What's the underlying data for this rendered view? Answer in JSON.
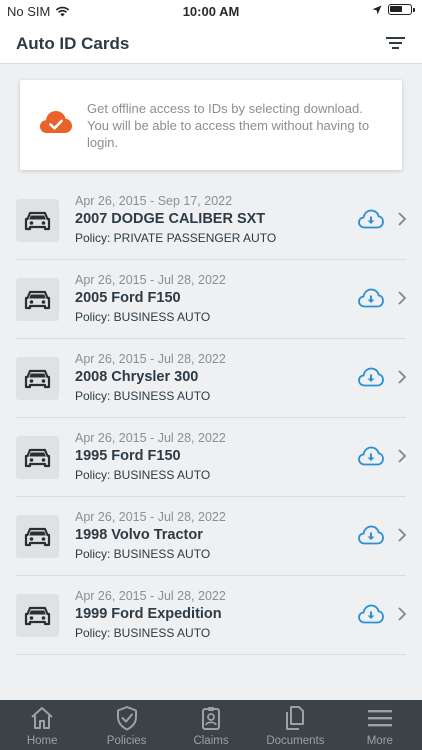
{
  "status": {
    "carrier": "No SIM",
    "time": "10:00 AM"
  },
  "header": {
    "title": "Auto ID Cards"
  },
  "notice": {
    "text": "Get offline access to IDs by selecting download. You will be able to access them without having to login."
  },
  "colors": {
    "accent_orange": "#e8632a",
    "download_blue": "#2b8fd6",
    "tabbar_bg": "#3b4248"
  },
  "cards": [
    {
      "dates": "Apr 26, 2015 - Sep 17, 2022",
      "vehicle": "2007 DODGE CALIBER SXT",
      "policy": "Policy: PRIVATE PASSENGER AUTO"
    },
    {
      "dates": "Apr 26, 2015 - Jul 28, 2022",
      "vehicle": "2005 Ford F150",
      "policy": "Policy: BUSINESS AUTO"
    },
    {
      "dates": "Apr 26, 2015 - Jul 28, 2022",
      "vehicle": "2008 Chrysler 300",
      "policy": "Policy: BUSINESS AUTO"
    },
    {
      "dates": "Apr 26, 2015 - Jul 28, 2022",
      "vehicle": "1995 Ford F150",
      "policy": "Policy: BUSINESS AUTO"
    },
    {
      "dates": "Apr 26, 2015 - Jul 28, 2022",
      "vehicle": "1998 Volvo Tractor",
      "policy": "Policy: BUSINESS AUTO"
    },
    {
      "dates": "Apr 26, 2015 - Jul 28, 2022",
      "vehicle": "1999 Ford Expedition",
      "policy": "Policy: BUSINESS AUTO"
    }
  ],
  "tabs": [
    {
      "label": "Home",
      "icon": "home-icon"
    },
    {
      "label": "Policies",
      "icon": "shield-check-icon"
    },
    {
      "label": "Claims",
      "icon": "id-badge-icon"
    },
    {
      "label": "Documents",
      "icon": "documents-icon"
    },
    {
      "label": "More",
      "icon": "menu-icon"
    }
  ]
}
